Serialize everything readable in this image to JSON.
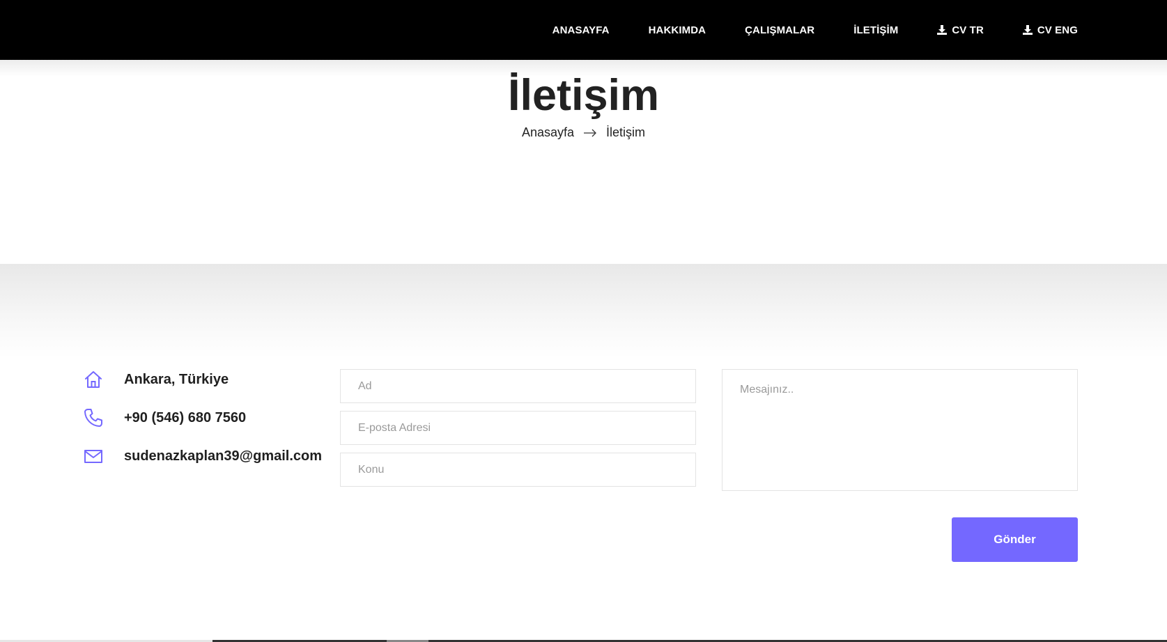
{
  "nav": {
    "items": [
      {
        "label": "ANASAYFA"
      },
      {
        "label": "HAKKIMDA"
      },
      {
        "label": "ÇALIŞMALAR"
      },
      {
        "label": "İLETİŞİM"
      },
      {
        "label": "CV TR",
        "icon": "download-icon"
      },
      {
        "label": "CV ENG",
        "icon": "download-icon"
      }
    ]
  },
  "hero": {
    "title": "İletişim",
    "breadcrumb": {
      "home": "Anasayfa",
      "separator_icon": "arrow-right-icon",
      "current": "İletişim"
    }
  },
  "contact": {
    "address": {
      "icon": "home-icon",
      "text": "Ankara, Türkiye"
    },
    "phone": {
      "icon": "phone-icon",
      "text": "+90 (546) 680 7560"
    },
    "email": {
      "icon": "mail-icon",
      "text": "sudenazkaplan39@gmail.com"
    }
  },
  "form": {
    "name_placeholder": "Ad",
    "name_value": "",
    "email_placeholder": "E-posta Adresi",
    "email_value": "",
    "subject_placeholder": "Konu",
    "subject_value": "",
    "message_placeholder": "Mesajınız..",
    "message_value": "",
    "submit_label": "Gönder"
  },
  "colors": {
    "accent": "#7468ff",
    "nav_bg": "#000000",
    "text": "#1f1f1f"
  }
}
